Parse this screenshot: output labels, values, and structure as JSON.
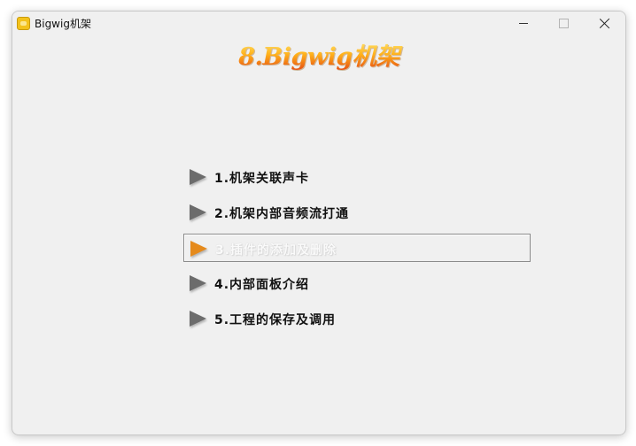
{
  "window": {
    "title": "Bigwig机架",
    "icon": "app-icon"
  },
  "banner": {
    "text": "8.Bigwig机架"
  },
  "menu": {
    "items": [
      {
        "label": "1.机架关联声卡",
        "selected": false
      },
      {
        "label": "2.机架内部音频流打通",
        "selected": false
      },
      {
        "label": "3.插件的添加及删除",
        "selected": true
      },
      {
        "label": "4.内部面板介绍",
        "selected": false
      },
      {
        "label": "5.工程的保存及调用",
        "selected": false
      }
    ]
  },
  "colors": {
    "arrow_default": "#6c6c6c",
    "arrow_selected": "#e58a1c",
    "window_bg": "#f0f0f0"
  }
}
